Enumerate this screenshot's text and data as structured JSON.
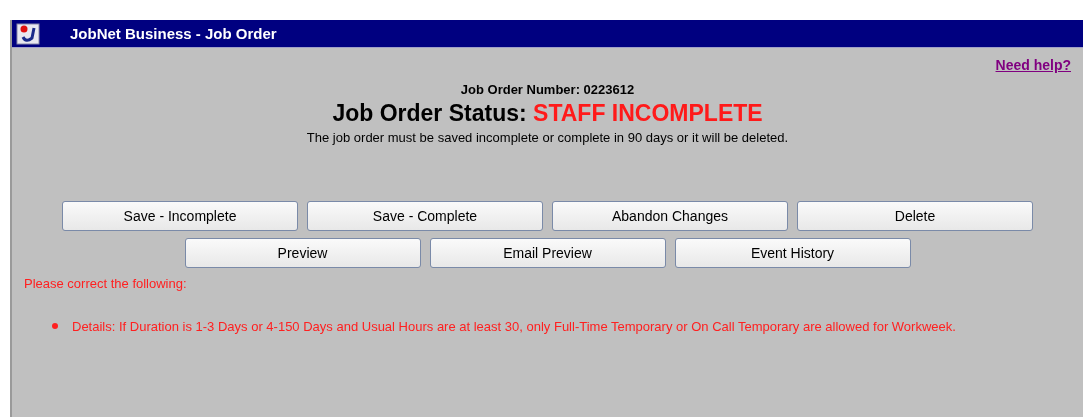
{
  "window": {
    "title": "JobNet Business - Job Order"
  },
  "help_link": "Need help?",
  "job_order_number": {
    "label": "Job Order Number:",
    "value": "0223612"
  },
  "status": {
    "label": "Job Order Status:",
    "value": "STAFF INCOMPLETE"
  },
  "notice": "The job order must be saved incomplete or complete in 90 days or it will be deleted.",
  "button_rows": [
    [
      "Save - Incomplete",
      "Save - Complete",
      "Abandon Changes",
      "Delete"
    ],
    [
      "Preview",
      "Email Preview",
      "Event History"
    ]
  ],
  "errors": {
    "heading": "Please correct the following:",
    "items": [
      "Details: If Duration is 1-3 Days or 4-150 Days and Usual Hours are at least 30, only Full-Time Temporary or On Call Temporary are allowed for Workweek."
    ]
  }
}
